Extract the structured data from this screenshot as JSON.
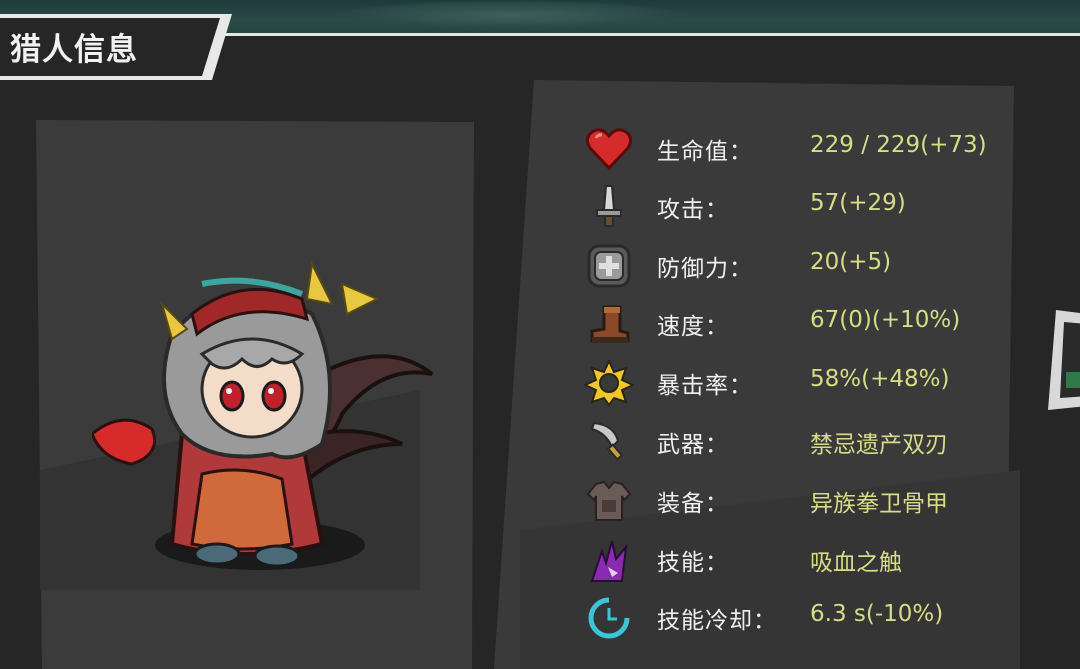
{
  "header": {
    "title": "猎人信息"
  },
  "stats": [
    {
      "icon": "heart-icon",
      "label": "生命值：",
      "value": "229 / 229(+73)"
    },
    {
      "icon": "sword-icon",
      "label": "攻击：",
      "value": "57(+29)"
    },
    {
      "icon": "shield-icon",
      "label": "防御力：",
      "value": "20(+5)"
    },
    {
      "icon": "boot-icon",
      "label": "速度：",
      "value": "67(0)(+10%)"
    },
    {
      "icon": "critical-star-icon",
      "label": "暴击率：",
      "value": "58%(+48%)"
    },
    {
      "icon": "weapon-blade-icon",
      "label": "武器：",
      "value": "禁忌遗产双刃"
    },
    {
      "icon": "armor-icon",
      "label": "装备：",
      "value": "异族拳卫骨甲"
    },
    {
      "icon": "skill-claw-icon",
      "label": "技能：",
      "value": "吸血之触"
    },
    {
      "icon": "cooldown-icon",
      "label": "技能冷却：",
      "value": "6.3 s(-10%)"
    }
  ],
  "colors": {
    "panel": "#262626",
    "card": "#3a3a3a",
    "label": "#f0f0f0",
    "value": "#d6dd84",
    "accent_red": "#d62b2b"
  }
}
